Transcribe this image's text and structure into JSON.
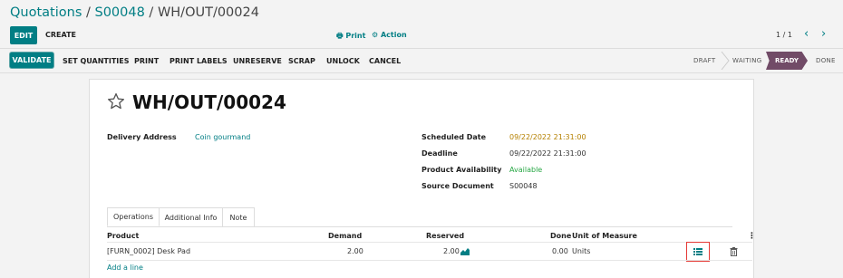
{
  "breadcrumb": {
    "parent1": "Quotations",
    "sep": " / ",
    "parent2": "S00048",
    "current": "WH/OUT/00024"
  },
  "control": {
    "edit_label": "EDIT",
    "create_label": "CREATE",
    "print_label": "Print",
    "action_label": "Action",
    "pager": "1 / 1"
  },
  "actions": {
    "validate": "VALIDATE",
    "set_quantities": "SET QUANTITIES",
    "print": "PRINT",
    "print_labels": "PRINT LABELS",
    "unreserve": "UNRESERVE",
    "scrap": "SCRAP",
    "unlock": "UNLOCK",
    "cancel": "CANCEL"
  },
  "status": {
    "stages": [
      "DRAFT",
      "WAITING",
      "READY",
      "DONE"
    ],
    "active": "READY"
  },
  "record": {
    "name": "WH/OUT/00024",
    "delivery_address_label": "Delivery Address",
    "delivery_address": "Coin gourmand",
    "scheduled_date_label": "Scheduled Date",
    "scheduled_date": "09/22/2022 21:31:00",
    "deadline_label": "Deadline",
    "deadline": "09/22/2022 21:31:00",
    "availability_label": "Product Availability",
    "availability": "Available",
    "source_label": "Source Document",
    "source": "S00048"
  },
  "tabs": [
    "Operations",
    "Additional Info",
    "Note"
  ],
  "table": {
    "headers": {
      "product": "Product",
      "demand": "Demand",
      "reserved": "Reserved",
      "done": "Done",
      "uom": "Unit of Measure"
    },
    "rows": [
      {
        "product": "[FURN_0002] Desk Pad",
        "demand": "2.00",
        "reserved": "2.00",
        "done": "0.00",
        "uom": "Units"
      }
    ],
    "add_line": "Add a line"
  },
  "colors": {
    "primary": "#017e84",
    "status_active": "#714b67",
    "warning_date": "#b58000",
    "available": "#28a745",
    "highlight": "#e53935"
  }
}
